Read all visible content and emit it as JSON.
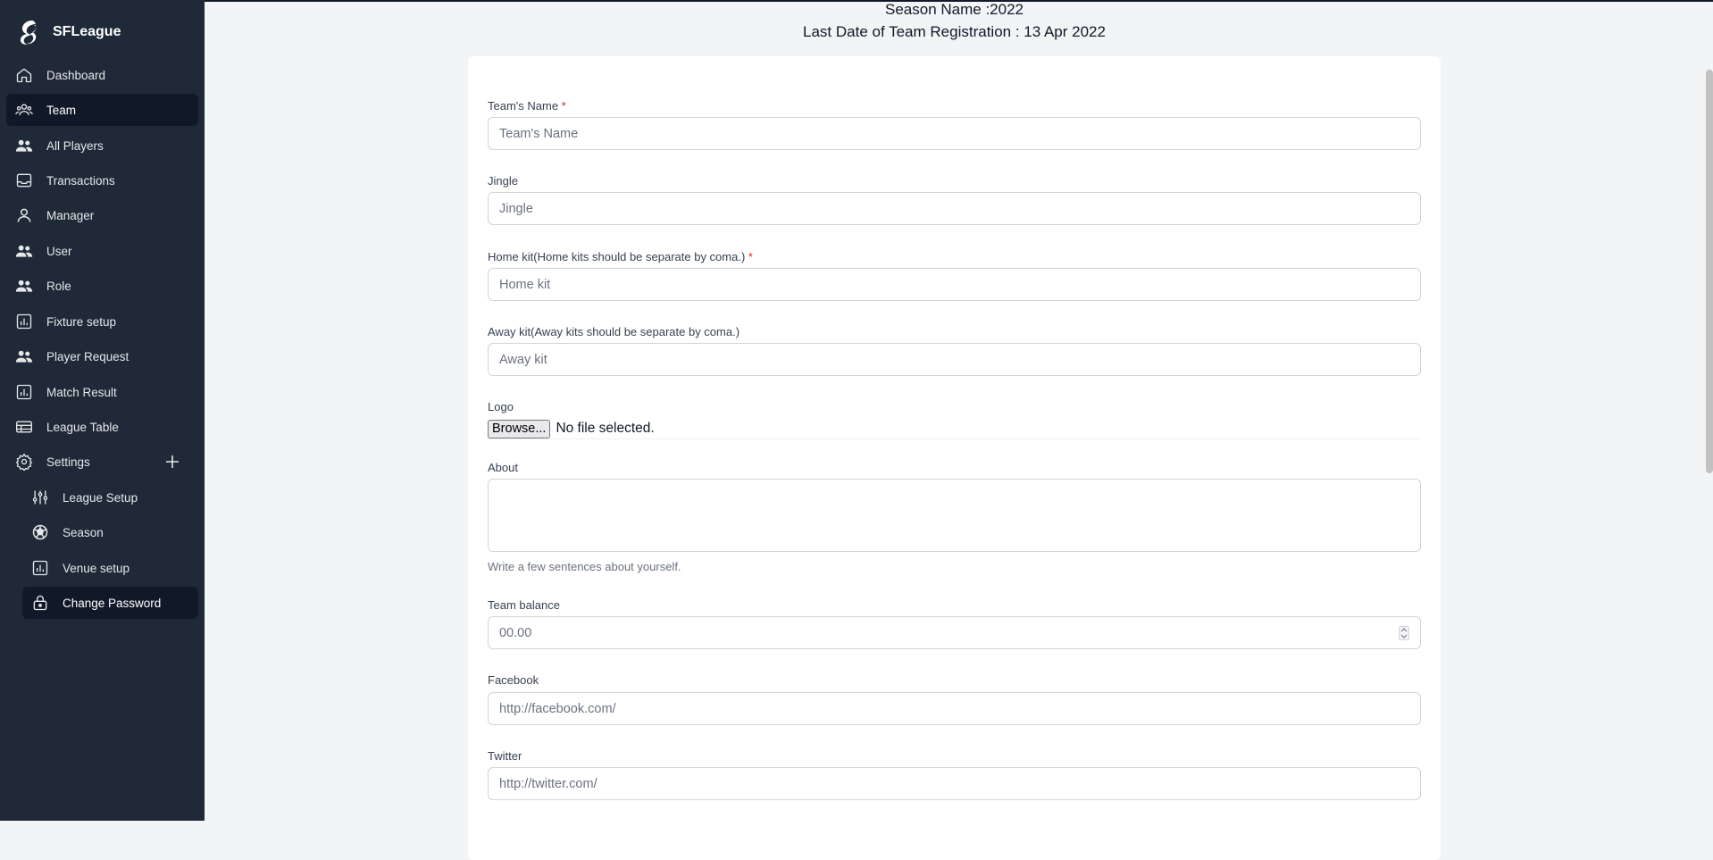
{
  "app": {
    "name": "SFLeague"
  },
  "sidebar": {
    "items": [
      {
        "label": "Dashboard",
        "icon": "home-icon"
      },
      {
        "label": "Team",
        "icon": "team-icon"
      },
      {
        "label": "All Players",
        "icon": "users-icon"
      },
      {
        "label": "Transactions",
        "icon": "inbox-icon"
      },
      {
        "label": "Manager",
        "icon": "user-icon"
      },
      {
        "label": "User",
        "icon": "users-icon"
      },
      {
        "label": "Role",
        "icon": "users-icon"
      },
      {
        "label": "Fixture setup",
        "icon": "chart-icon"
      },
      {
        "label": "Player Request",
        "icon": "users-icon"
      },
      {
        "label": "Match Result",
        "icon": "chart-icon"
      },
      {
        "label": "League Table",
        "icon": "table-icon"
      },
      {
        "label": "Settings",
        "icon": "gear-icon"
      }
    ],
    "settings_children": [
      {
        "label": "League Setup",
        "icon": "sliders-icon"
      },
      {
        "label": "Season",
        "icon": "ball-icon"
      },
      {
        "label": "Venue setup",
        "icon": "chart-icon"
      },
      {
        "label": "Change Password",
        "icon": "lock-icon"
      }
    ],
    "active": "Team"
  },
  "header": {
    "season": "Season Name :2022",
    "deadline": "Last Date of Team Registration : 13 Apr 2022"
  },
  "form": {
    "team_name": {
      "label": "Team's Name",
      "required_mark": "*",
      "placeholder": "Team's Name",
      "value": ""
    },
    "jingle": {
      "label": "Jingle",
      "placeholder": "Jingle",
      "value": ""
    },
    "home_kit": {
      "label": "Home kit(Home kits should be separate by coma.)",
      "required_mark": "*",
      "placeholder": "Home kit",
      "value": ""
    },
    "away_kit": {
      "label": "Away kit(Away kits should be separate by coma.)",
      "placeholder": "Away kit",
      "value": ""
    },
    "logo": {
      "label": "Logo",
      "button": "Browse...",
      "status": "No file selected."
    },
    "about": {
      "label": "About",
      "help": "Write a few sentences about yourself.",
      "value": ""
    },
    "team_balance": {
      "label": "Team balance",
      "placeholder": "00.00",
      "value": ""
    },
    "facebook": {
      "label": "Facebook",
      "placeholder": "http://facebook.com/",
      "value": ""
    },
    "twitter": {
      "label": "Twitter",
      "placeholder": "http://twitter.com/",
      "value": ""
    }
  },
  "colors": {
    "sidebar_bg": "#1f2937",
    "active_bg": "#111827",
    "required": "#dc2626"
  }
}
